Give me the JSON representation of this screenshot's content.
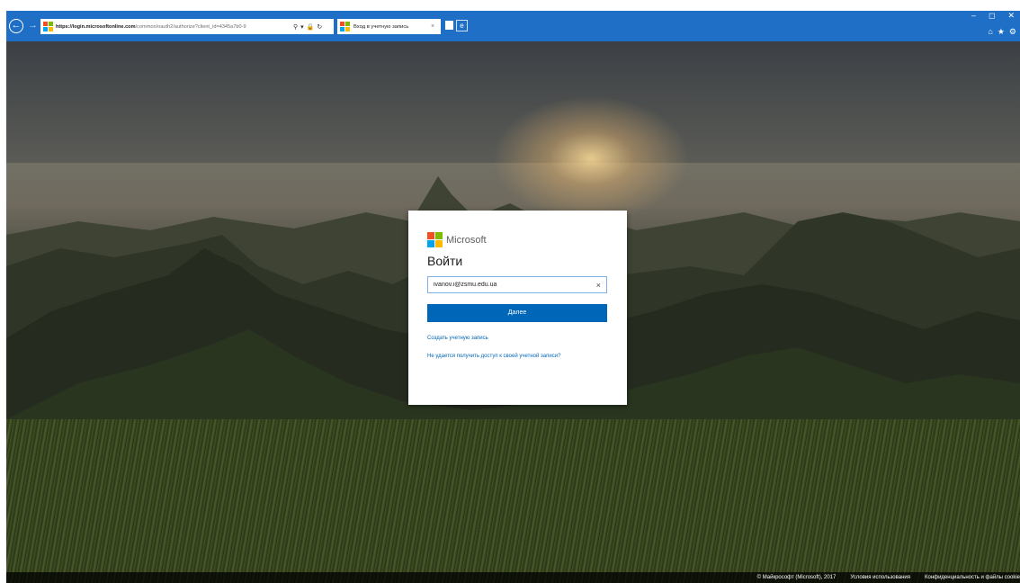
{
  "browser": {
    "url_prefix": "https://login.microsoftonline.com",
    "url_rest": "/common/oauth2/authorize?client_id=4345a7b0-9",
    "tab_title": "Вход в учетную запись",
    "tab_close": "×"
  },
  "card": {
    "brand": "Microsoft",
    "title": "Войти",
    "email_value": "ivanov.i@zsmu.edu.ua",
    "clear_symbol": "×",
    "next_label": "Далее",
    "create_account": "Создать учетную запись",
    "cant_access": "Не удается получить доступ к своей учетной записи?"
  },
  "footer": {
    "copyright": "© Майкрософт (Microsoft), 2017",
    "terms": "Условия использования",
    "privacy": "Конфиденциальность и файлы cookie"
  },
  "colors": {
    "brand_red": "#f25022",
    "brand_green": "#7fba00",
    "brand_blue": "#00a4ef",
    "brand_yellow": "#ffb900",
    "accent": "#0067b8",
    "chrome": "#1f6fc6"
  },
  "icons": [
    "back-icon",
    "forward-icon",
    "search-icon",
    "refresh-icon",
    "lock-icon",
    "new-tab-icon",
    "home-icon",
    "favorites-icon",
    "settings-icon"
  ]
}
